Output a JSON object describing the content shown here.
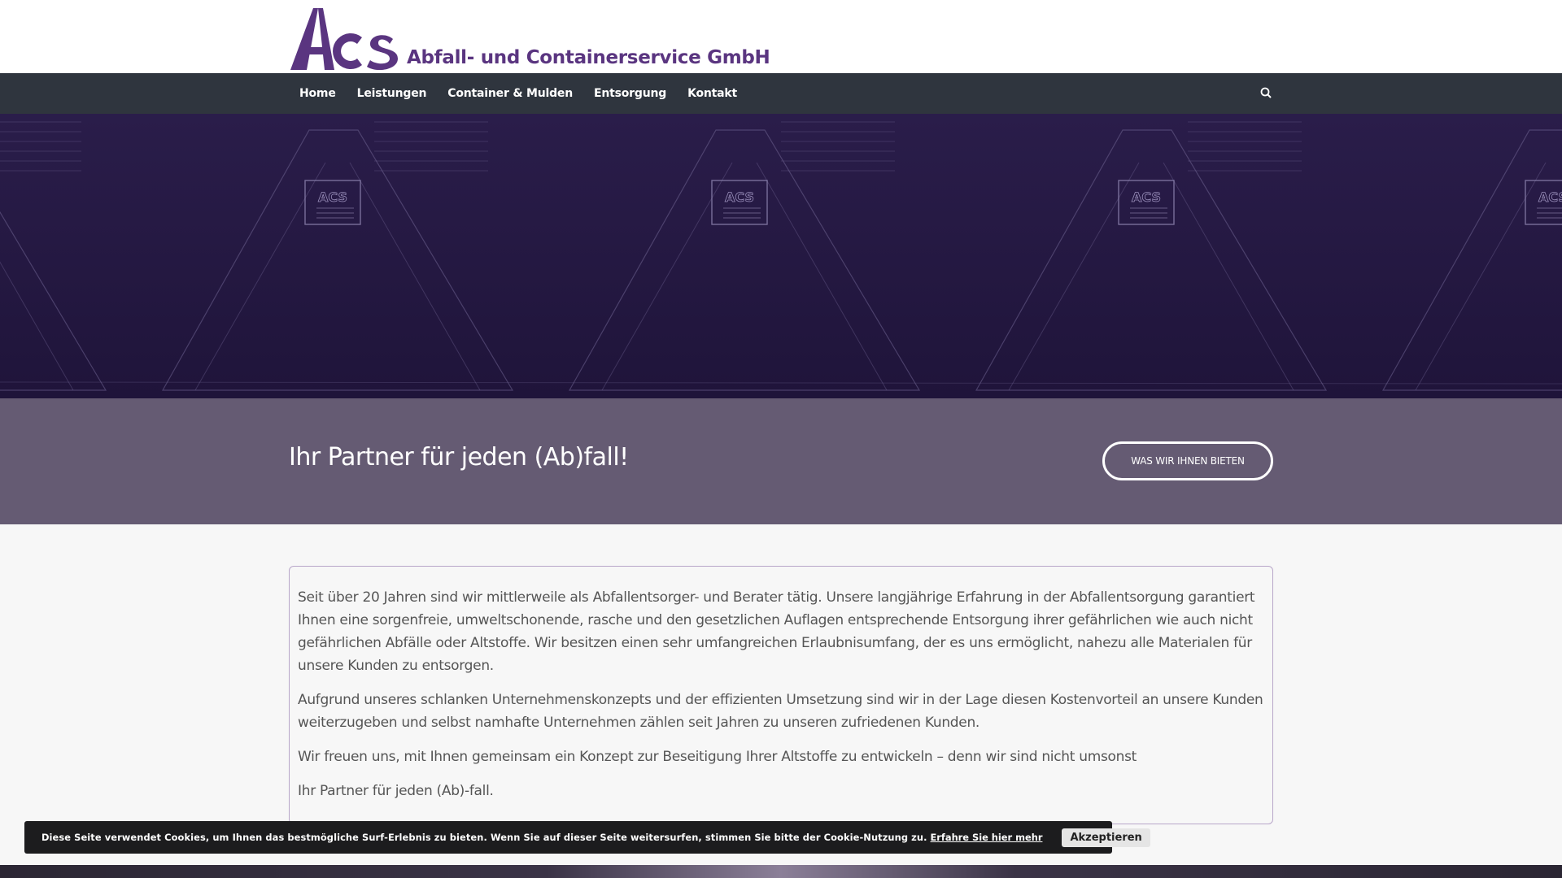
{
  "header": {
    "logo_text": "ACS",
    "company_name": "Abfall- und Containerservice GmbH"
  },
  "nav": {
    "items": [
      {
        "label": "Home"
      },
      {
        "label": "Leistungen"
      },
      {
        "label": "Container & Mulden"
      },
      {
        "label": "Entsorgung"
      },
      {
        "label": "Kontakt"
      }
    ],
    "search_icon": "search-icon"
  },
  "hero": {
    "image": "container-photo",
    "sign_text": "ACS"
  },
  "tagline": {
    "text": "Ihr Partner für jeden (Ab)fall!",
    "button_label": "WAS WIR IHNEN BIETEN"
  },
  "content": {
    "paragraphs": [
      "Seit über 20 Jahren sind wir mittlerweile als Abfallentsorger- und Berater tätig. Unsere langjährige Erfahrung in der Abfallentsorgung garantiert Ihnen eine sorgenfreie, umweltschonende, rasche und den gesetzlichen Auflagen entsprechende Entsorgung ihrer gefährlichen wie auch nicht gefährlichen Abfälle oder Altstoffe. Wir besitzen einen sehr umfangreichen Erlaubnisumfang, der es uns ermöglicht, nahezu alle Materialen für unsere Kunden zu entsorgen.",
      "Aufgrund unseres schlanken Unternehmenskonzepts und der effizienten Umsetzung sind wir in der Lage diesen Kostenvorteil an unsere Kunden weiterzugeben und selbst namhafte Unternehmen zählen seit Jahren zu unseren zufriedenen Kunden.",
      "Wir freuen uns, mit Ihnen gemeinsam ein Konzept zur Beseitigung Ihrer Altstoffe zu entwickeln – denn wir sind nicht umsonst",
      "Ihr Partner für jeden (Ab)-fall."
    ]
  },
  "cookie": {
    "text": "Diese Seite verwendet Cookies, um Ihnen das bestmögliche Surf-Erlebnis zu bieten. Wenn Sie auf dieser Seite weitersurfen, stimmen Sie bitte der Cookie-Nutzung zu.",
    "link_label": "Erfahre Sie hier mehr",
    "accept_label": "Akzeptieren"
  },
  "colors": {
    "brand_purple": "#5a3580",
    "nav_bg": "#2f353e",
    "hero_bg": "#231640",
    "band_bg": "#655b73"
  }
}
